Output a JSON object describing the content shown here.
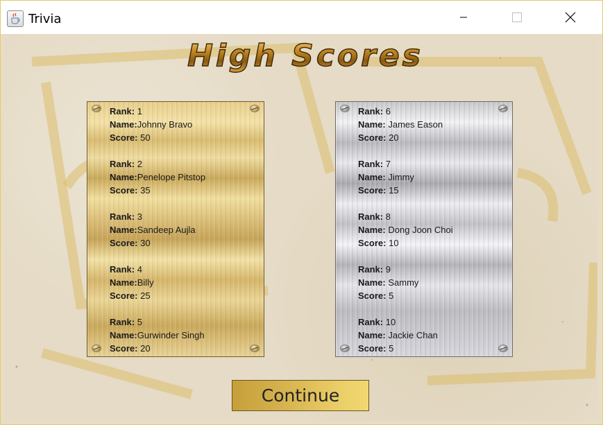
{
  "window": {
    "title": "Trivia",
    "icon": "java-cup-icon"
  },
  "heading": {
    "text": "High Scores"
  },
  "labels": {
    "rank": "Rank:",
    "name": "Name:",
    "score": "Score:"
  },
  "panels": [
    {
      "theme": "gold",
      "entries": [
        {
          "rank": "1",
          "name": "Johnny Bravo",
          "score": "50"
        },
        {
          "rank": "2",
          "name": "Penelope Pitstop",
          "score": "35"
        },
        {
          "rank": "3",
          "name": "Sandeep Aujla",
          "score": "30"
        },
        {
          "rank": "4",
          "name": "Billy",
          "score": "25"
        },
        {
          "rank": "5",
          "name": "Gurwinder Singh",
          "score": "20"
        }
      ]
    },
    {
      "theme": "silver",
      "entries": [
        {
          "rank": "6",
          "name": "James Eason",
          "score": "20"
        },
        {
          "rank": "7",
          "name": "Jimmy",
          "score": "15"
        },
        {
          "rank": "8",
          "name": "Dong Joon Choi",
          "score": "10"
        },
        {
          "rank": "9",
          "name": "Sammy",
          "score": "5"
        },
        {
          "rank": "10",
          "name": "Jackie Chan",
          "score": "5"
        }
      ]
    }
  ],
  "continue_button": {
    "label": "Continue"
  },
  "colors": {
    "gold": "#d9bc72",
    "silver": "#c8c8cc",
    "button": "#d7b450",
    "heading": "#b8861f"
  }
}
